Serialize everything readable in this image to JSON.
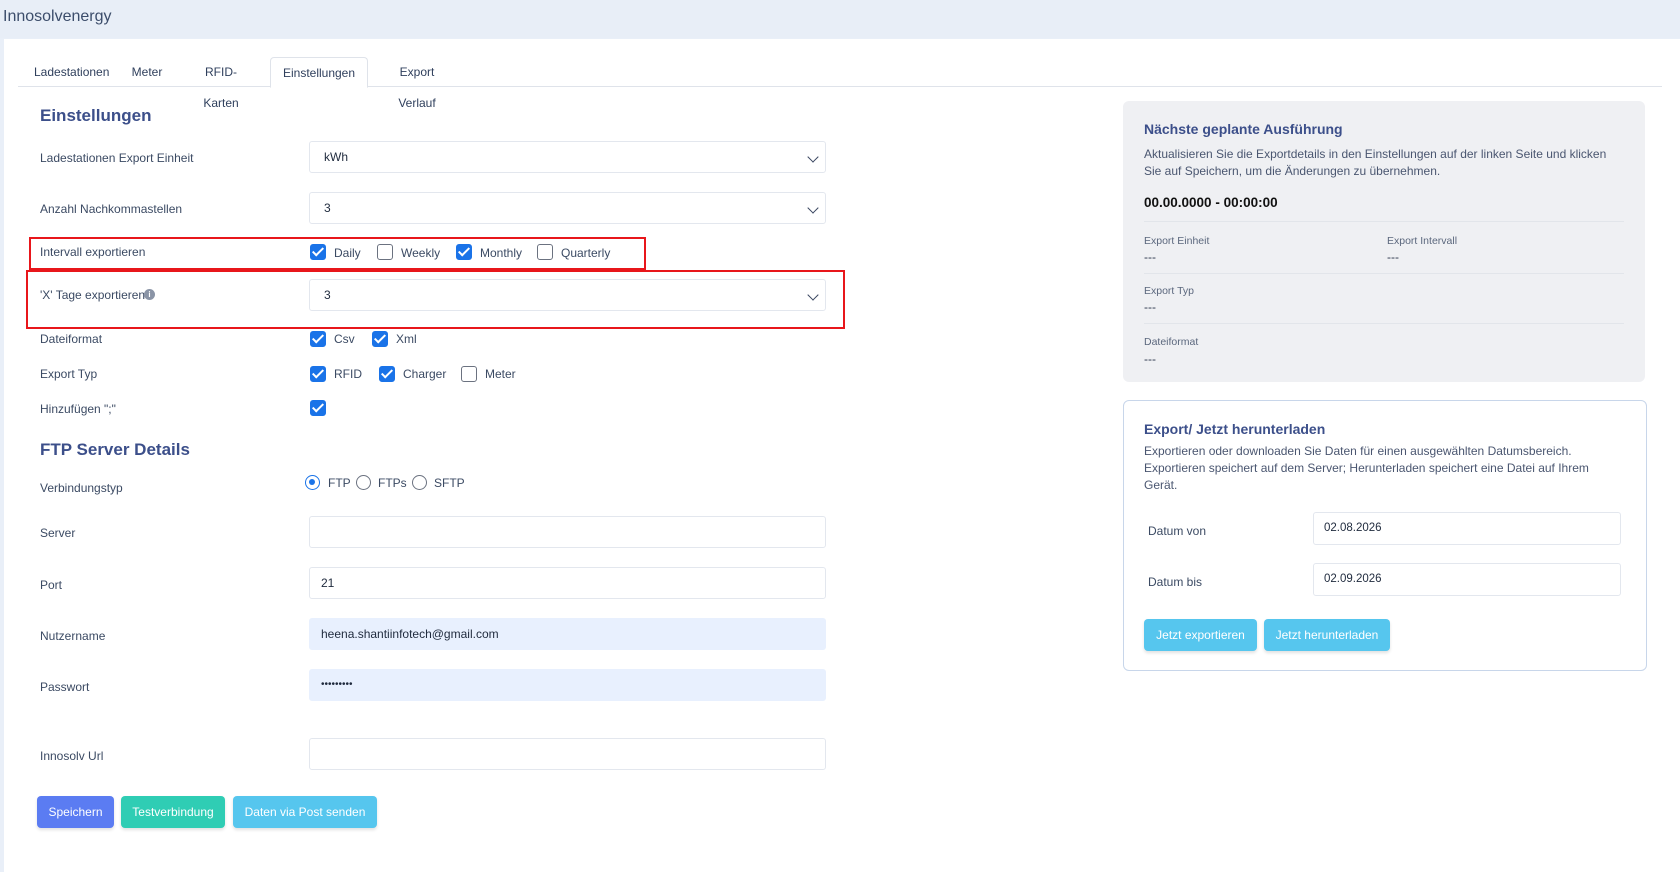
{
  "app": {
    "brand": "Innosolvenergy"
  },
  "tabs": [
    {
      "label": "Ladestationen"
    },
    {
      "label": "Meter"
    },
    {
      "label": "RFID-Karten"
    },
    {
      "label": "Einstellungen",
      "active": true
    },
    {
      "label": "Export Verlauf"
    }
  ],
  "settings": {
    "title": "Einstellungen",
    "export_unit": {
      "label": "Ladestationen Export Einheit",
      "value": "kWh"
    },
    "decimals": {
      "label": "Anzahl Nachkommastellen",
      "value": "3"
    },
    "interval": {
      "label": "Intervall exportieren",
      "options": [
        {
          "label": "Daily",
          "checked": true
        },
        {
          "label": "Weekly",
          "checked": false
        },
        {
          "label": "Monthly",
          "checked": true
        },
        {
          "label": "Quarterly",
          "checked": false
        }
      ]
    },
    "x_days": {
      "label": "'X' Tage exportieren",
      "value": "3",
      "info_icon": "info-icon"
    },
    "file_format": {
      "label": "Dateiformat",
      "options": [
        {
          "label": "Csv",
          "checked": true
        },
        {
          "label": "Xml",
          "checked": true
        }
      ]
    },
    "export_type": {
      "label": "Export Typ",
      "options": [
        {
          "label": "RFID",
          "checked": true
        },
        {
          "label": "Charger",
          "checked": true
        },
        {
          "label": "Meter",
          "checked": false
        }
      ]
    },
    "add_semicolon": {
      "label": "Hinzufügen \";\"",
      "checked": true
    }
  },
  "ftp": {
    "title": "FTP Server Details",
    "connection_type": {
      "label": "Verbindungstyp",
      "options": [
        {
          "label": "FTP",
          "selected": true
        },
        {
          "label": "FTPs",
          "selected": false
        },
        {
          "label": "SFTP",
          "selected": false
        }
      ]
    },
    "server": {
      "label": "Server",
      "value": ""
    },
    "port": {
      "label": "Port",
      "value": "21"
    },
    "username": {
      "label": "Nutzername",
      "value": "heena.shantiinfotech@gmail.com"
    },
    "password": {
      "label": "Passwort",
      "value": "•••••••••"
    },
    "innosolv_url": {
      "label": "Innosolv Url",
      "value": ""
    }
  },
  "actions": {
    "save": "Speichern",
    "test": "Testverbindung",
    "post": "Daten via Post senden"
  },
  "next_run": {
    "title": "Nächste geplante Ausführung",
    "description_line1": "Aktualisieren Sie die Exportdetails in den Einstellungen auf der linken Seite und klicken",
    "description_line2": "Sie auf Speichern, um die Änderungen zu übernehmen.",
    "datetime": "00.00.0000 - 00:00:00",
    "export_unit_label": "Export Einheit",
    "export_unit_value": "---",
    "export_interval_label": "Export Intervall",
    "export_interval_value": "---",
    "export_type_label": "Export Typ",
    "export_type_value": "---",
    "file_format_label": "Dateiformat",
    "file_format_value": "---"
  },
  "export_now": {
    "title": "Export/ Jetzt herunterladen",
    "description_line1": "Exportieren oder downloaden Sie Daten für einen ausgewählten Datumsbereich.",
    "description_line2": "Exportieren speichert auf dem Server; Herunterladen speichert eine Datei auf Ihrem",
    "description_line3": "Gerät.",
    "date_from_label": "Datum von",
    "date_from_value": "02.08.2026",
    "date_to_label": "Datum bis",
    "date_to_value": "02.09.2026",
    "export_button": "Jetzt exportieren",
    "download_button": "Jetzt herunterladen"
  },
  "colors": {
    "accent": "#1a73e8",
    "highlight_box": "#e8161b",
    "btn_save": "#5b7cf2",
    "btn_test": "#2fcdb4",
    "btn_post": "#56c6ee"
  }
}
